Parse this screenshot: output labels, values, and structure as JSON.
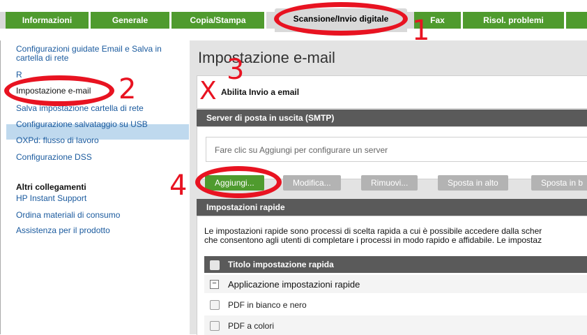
{
  "tabs": [
    {
      "label": "Informazioni"
    },
    {
      "label": "Generale"
    },
    {
      "label": "Copia/Stampa"
    },
    {
      "label": "Scansione/Invio digitale"
    },
    {
      "label": "Fax"
    },
    {
      "label": "Risol. problemi"
    }
  ],
  "nav": {
    "items": [
      "Configurazioni guidate Email e Salva in cartella di rete",
      "Impostazione e-mail",
      "Salva impostazione cartella di rete",
      "Configurazione salvataggio su USB",
      "OXPd: flusso di lavoro",
      "Configurazione DSS"
    ],
    "truncated_item": "R",
    "other_links_heading": "Altri collegamenti",
    "other_links": [
      "HP Instant Support",
      "Ordina materiali di consumo",
      "Assistenza per il prodotto"
    ]
  },
  "main": {
    "title": "Impostazione e-mail",
    "enable_label": "Abilita Invio a email",
    "smtp_header": "Server di posta in uscita (SMTP)",
    "smtp_placeholder": "Fare clic su Aggiungi per configurare un server",
    "buttons": [
      "Aggiungi...",
      "Modifica...",
      "Rimuovi...",
      "Sposta in alto",
      "Sposta in b"
    ],
    "quick_header": "Impostazioni rapide",
    "quick_desc_1": "Le impostazioni rapide sono processi di scelta rapida a cui è possibile accedere dalla scher",
    "quick_desc_2": "che consentono agli utenti di completare i processi in modo rapido e affidabile. Le impostaz",
    "table_header": "Titolo impostazione rapida",
    "group_label": "Applicazione impostazioni rapide",
    "group_toggle": "−",
    "rows": [
      "PDF in bianco e nero",
      "PDF a colori"
    ]
  },
  "annotations": {
    "n1": "1",
    "n2": "2",
    "n3": "3",
    "n4": "4",
    "x": "X"
  },
  "colors": {
    "tab_green": "#4f9b2e",
    "header_gray": "#5a5a5a",
    "link_blue": "#1a5a9e",
    "annotation_red": "#e81321"
  }
}
